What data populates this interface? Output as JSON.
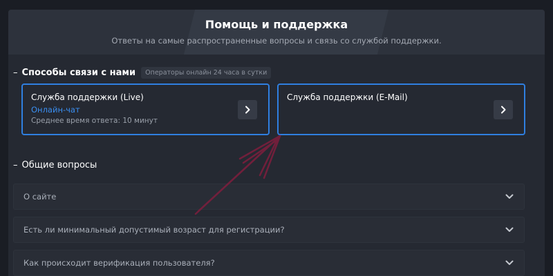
{
  "header": {
    "title": "Помощь и поддержка",
    "subtitle": "Ответы на самые распространенные вопросы и связь со службой поддержки."
  },
  "contact_section": {
    "dash": "–",
    "title": "Способы связи с нами",
    "badge": "Операторы онлайн 24 часа в сутки",
    "cards": [
      {
        "title": "Служба поддержки (Live)",
        "link": "Онлайн-чат",
        "meta": "Среднее время ответа: 10 минут"
      },
      {
        "title": "Служба поддержки (E-Mail)"
      }
    ]
  },
  "faq_section": {
    "dash": "–",
    "title": "Общие вопросы",
    "items": [
      {
        "question": "О сайте"
      },
      {
        "question": "Есть ли минимальный допустимый возраст для регистрации?"
      },
      {
        "question": "Как происходит верификация пользователя?"
      }
    ]
  },
  "colors": {
    "accent": "#2f7fe0",
    "link": "#3a8ef0",
    "annotation_arrow": "#7a1f3d"
  },
  "icons": {
    "card_arrow": "chevron-right-icon",
    "faq_toggle": "chevron-down-icon"
  }
}
